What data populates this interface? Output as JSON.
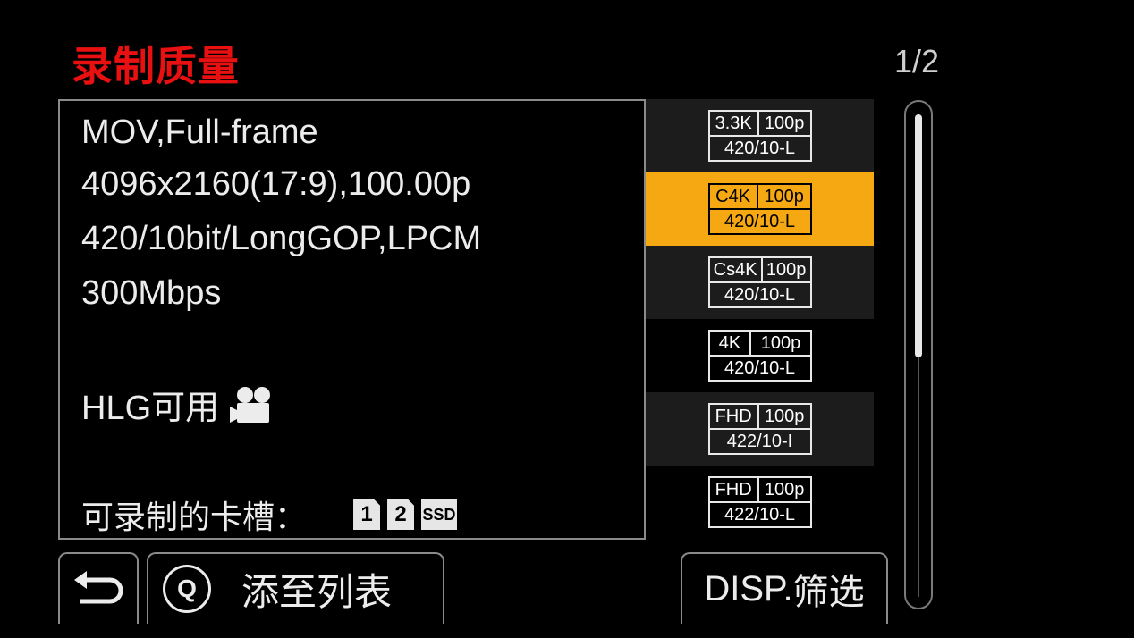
{
  "header": {
    "title": "录制质量",
    "page_indicator": "1/2"
  },
  "info": {
    "line1": "MOV,Full-frame",
    "line2": "4096x2160(17:9),100.00p",
    "line3": "420/10bit/LongGOP,LPCM",
    "line4": "300Mbps",
    "hlg_label": "HLG可用",
    "hlg_icon": "movie-camera-icon",
    "slots_label": "可录制的卡槽：",
    "slots": [
      "1",
      "2",
      "SSD"
    ]
  },
  "list": {
    "items": [
      {
        "res": "3.3K",
        "fps": "100p",
        "fmt": "420/10-L",
        "selected": false
      },
      {
        "res": "C4K",
        "fps": "100p",
        "fmt": "420/10-L",
        "selected": true
      },
      {
        "res": "Cs4K",
        "fps": "100p",
        "fmt": "420/10-L",
        "selected": false
      },
      {
        "res": "4K",
        "fps": "100p",
        "fmt": "420/10-L",
        "selected": false
      },
      {
        "res": "FHD",
        "fps": "100p",
        "fmt": "422/10-I",
        "selected": false
      },
      {
        "res": "FHD",
        "fps": "100p",
        "fmt": "422/10-L",
        "selected": false
      }
    ]
  },
  "buttons": {
    "back_icon": "return-arrow-icon",
    "q_label": "Q",
    "add_label": "添至列表",
    "disp_label": "DISP.",
    "filter_label": "筛选"
  },
  "colors": {
    "title": "#e81010",
    "selected": "#f5a812"
  }
}
